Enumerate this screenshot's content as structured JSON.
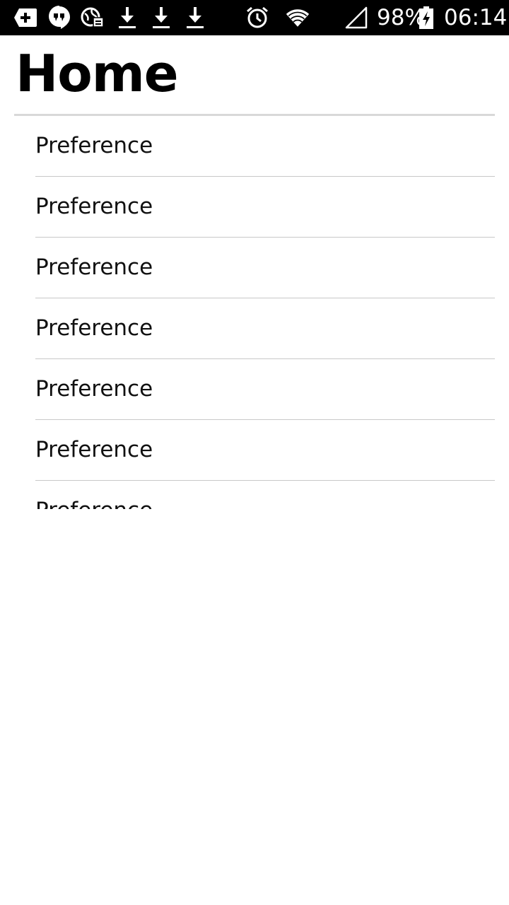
{
  "status_bar": {
    "battery": "98%",
    "time": "06:14",
    "icons": [
      "add-message-icon",
      "hangouts-icon",
      "vpn-globe-icon",
      "download-icon",
      "download-icon",
      "download-icon",
      "alarm-icon",
      "wifi-icon",
      "signal-icon",
      "battery-charging-icon"
    ]
  },
  "header": {
    "title": "Home"
  },
  "preferences": {
    "items": [
      {
        "label": "Preference"
      },
      {
        "label": "Preference"
      },
      {
        "label": "Preference"
      },
      {
        "label": "Preference"
      },
      {
        "label": "Preference"
      },
      {
        "label": "Preference"
      },
      {
        "label": "Preference"
      }
    ]
  },
  "colors": {
    "status_bar_bg": "#000000",
    "background": "#ffffff",
    "divider": "#c8c8c8"
  }
}
